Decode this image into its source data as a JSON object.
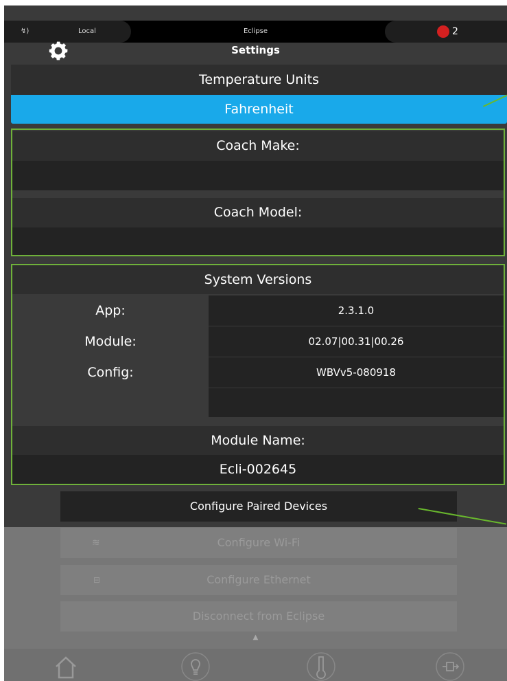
{
  "status_bar": {
    "connection": "Local",
    "device": "Eclipse",
    "alert_count": "2"
  },
  "header": {
    "title": "Settings",
    "icon": "gear-icon"
  },
  "temperature": {
    "label": "Temperature Units",
    "value": "Fahrenheit"
  },
  "coach": {
    "make_label": "Coach Make:",
    "make_value": "",
    "model_label": "Coach Model:",
    "model_value": ""
  },
  "versions": {
    "title": "System Versions",
    "rows": [
      {
        "label": "App:",
        "value": "2.3.1.0"
      },
      {
        "label": "Module:",
        "value": "02.07|00.31|00.26"
      },
      {
        "label": "Config:",
        "value": "WBVv5-080918"
      },
      {
        "label": "",
        "value": ""
      }
    ]
  },
  "module_name": {
    "label": "Module Name:",
    "value": "Ecli-002645"
  },
  "buttons": {
    "paired": "Configure Paired Devices",
    "wifi": "Configure Wi-Fi",
    "ethernet": "Configure Ethernet",
    "disconnect": "Disconnect from Eclipse"
  },
  "tabs": [
    "home-icon",
    "lightbulb-icon",
    "thermometer-icon",
    "slideout-icon"
  ],
  "colors": {
    "accent_blue": "#19a9ea",
    "highlight_green": "#6fb13a",
    "dark_row": "#232323",
    "mid_row": "#2e2e2e"
  }
}
